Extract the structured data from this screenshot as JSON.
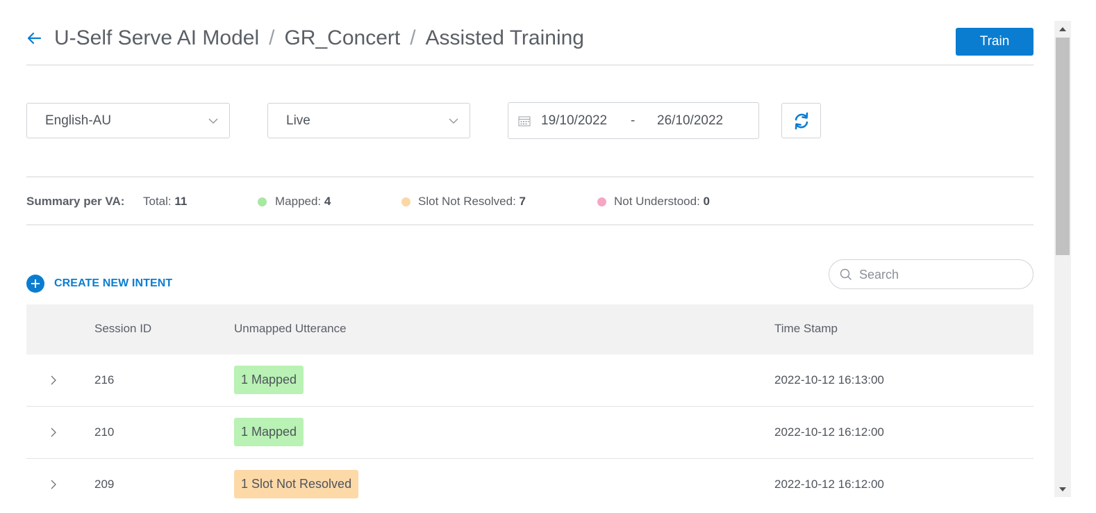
{
  "header": {
    "breadcrumb": [
      "U-Self Serve AI Model",
      "GR_Concert",
      "Assisted Training"
    ],
    "separator": "/",
    "train_label": "Train",
    "back_icon": "arrow-left-icon"
  },
  "filters": {
    "language": "English-AU",
    "environment": "Live",
    "date_from": "19/10/2022",
    "date_separator": "-",
    "date_to": "26/10/2022",
    "calendar_icon": "calendar-icon",
    "refresh_icon": "refresh-icon"
  },
  "summary": {
    "title": "Summary per VA:",
    "total_label": "Total:",
    "total_value": "11",
    "mapped_label": "Mapped:",
    "mapped_value": "4",
    "slot_label": "Slot Not Resolved:",
    "slot_value": "7",
    "not_understood_label": "Not Understood:",
    "not_understood_value": "0",
    "colors": {
      "mapped": "#a8e8a2",
      "slot": "#fbd7a6",
      "not_understood": "#f5a6c3"
    }
  },
  "actions": {
    "create_label": "CREATE NEW INTENT",
    "search_placeholder": "Search"
  },
  "table": {
    "headers": {
      "session": "Session ID",
      "utterance": "Unmapped Utterance",
      "timestamp": "Time Stamp"
    },
    "rows": [
      {
        "session_id": "216",
        "badge": "1 Mapped",
        "badge_type": "mapped",
        "timestamp": "2022-10-12 16:13:00"
      },
      {
        "session_id": "210",
        "badge": "1 Mapped",
        "badge_type": "mapped",
        "timestamp": "2022-10-12 16:12:00"
      },
      {
        "session_id": "209",
        "badge": "1 Slot Not Resolved",
        "badge_type": "slot",
        "timestamp": "2022-10-12 16:12:00"
      }
    ]
  },
  "theme": {
    "accent": "#0a7dd1"
  }
}
